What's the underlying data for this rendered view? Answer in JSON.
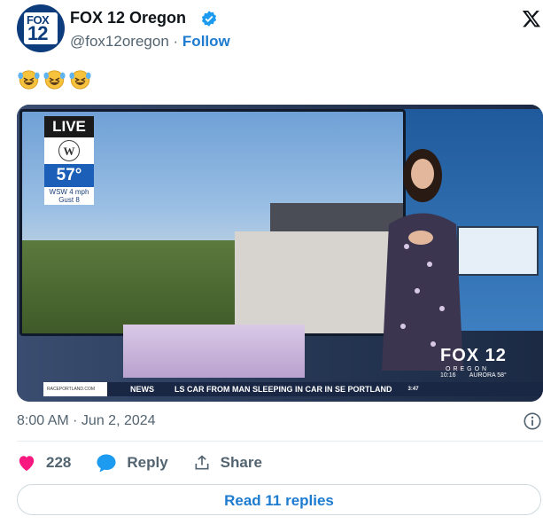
{
  "account": {
    "name": "FOX 12 Oregon",
    "handle": "@fox12oregon",
    "separator": "·",
    "follow_label": "Follow",
    "avatar_text_top": "FOX",
    "avatar_text_bottom": "12"
  },
  "post": {
    "emojis": [
      "rolling-on-floor-laughing",
      "rolling-on-floor-laughing",
      "rolling-on-floor-laughing"
    ],
    "timestamp": "8:00 AM · Jun 2, 2024"
  },
  "media": {
    "live_label": "LIVE",
    "weather_logo_letter": "W",
    "temperature": "57°",
    "wind_line1": "WSW 4 mph",
    "wind_line2": "Gust 8",
    "station_bug": "FOX 12",
    "station_sub": "OREGON",
    "bug_time": "10:16",
    "bug_location": "AURORA 58°",
    "ticker_logo_text": "RACEPORTLAND.COM",
    "ticker_news": "NEWS",
    "ticker_crawl": "LS CAR FROM MAN SLEEPING IN CAR IN SE PORTLAND",
    "ticker_end": "3:47"
  },
  "actions": {
    "like_count": "228",
    "reply_label": "Reply",
    "share_label": "Share",
    "read_replies_label": "Read 11 replies"
  },
  "colors": {
    "accent": "#1d7bd0",
    "heart": "#f91880",
    "reply_icon": "#1d9bf0",
    "verified": "#1d9bf0"
  }
}
